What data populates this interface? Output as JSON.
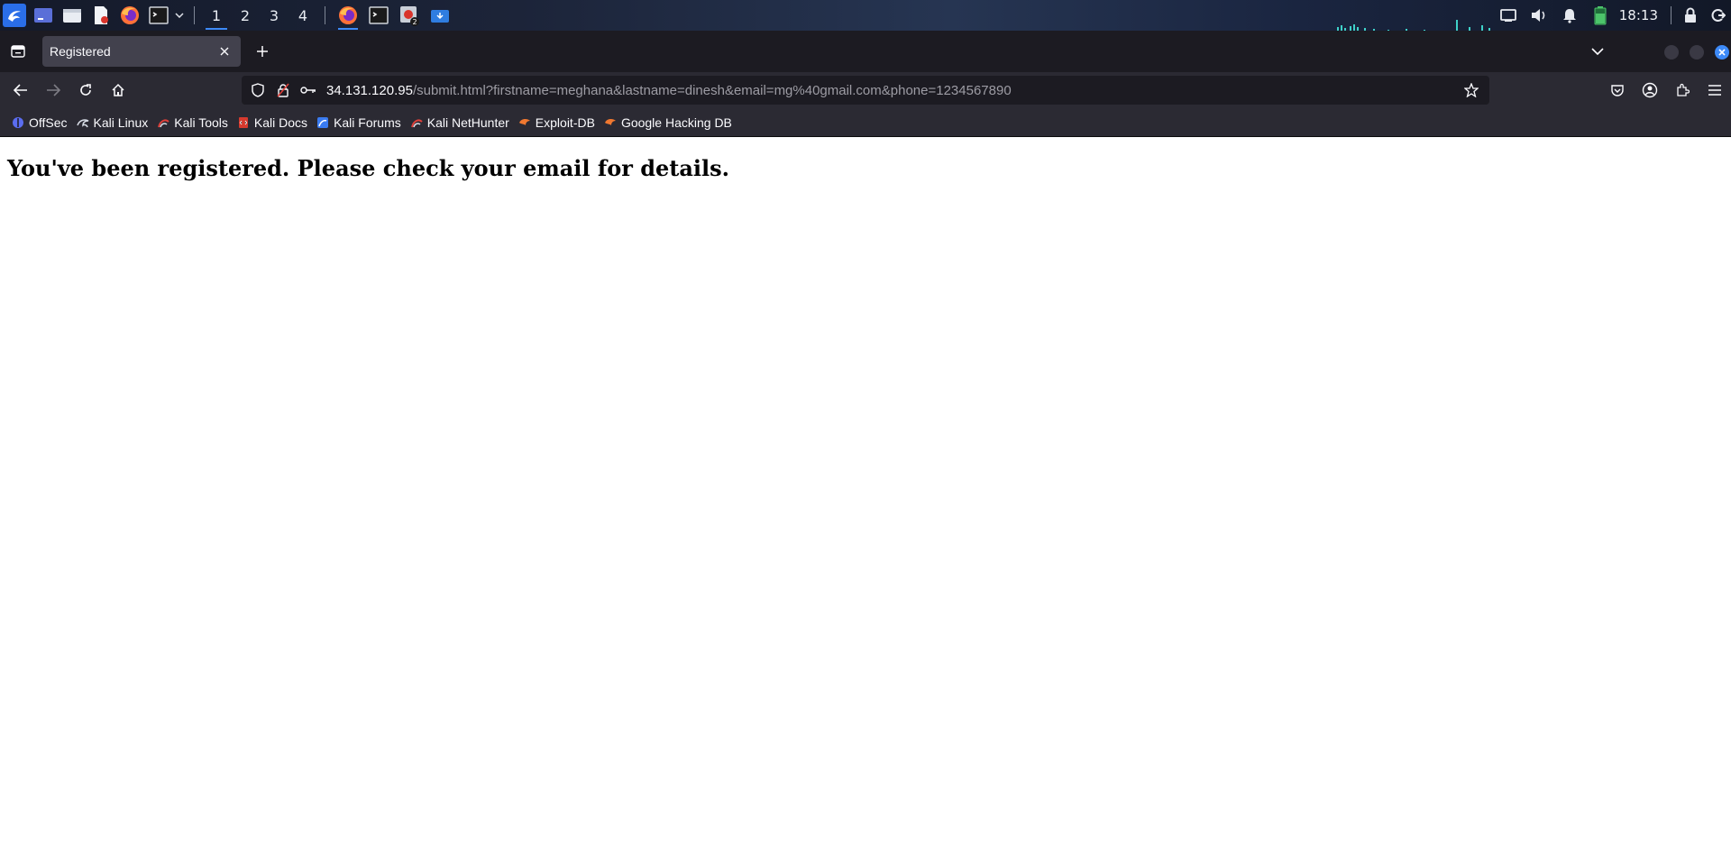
{
  "taskbar": {
    "workspaces": [
      "1",
      "2",
      "3",
      "4"
    ],
    "active_workspace": "1",
    "launchers": [
      "kali-menu-icon",
      "terminal-desktop-icon",
      "file-manager-icon",
      "text-editor-icon",
      "firefox-icon",
      "terminal-icon"
    ],
    "running_apps": [
      "firefox-icon",
      "terminal-icon",
      "screenshot-icon",
      "downloads-icon"
    ],
    "screenshot_badge": "2",
    "clock": "18:13"
  },
  "browser": {
    "tab": {
      "title": "Registered"
    },
    "url": {
      "host": "34.131.120.95",
      "path": "/submit.html?firstname=meghana&lastname=dinesh&email=mg%40gmail.com&phone=1234567890"
    },
    "bookmarks": [
      {
        "label": "OffSec",
        "icon": "offsec-icon",
        "color": "#5b6df0"
      },
      {
        "label": "Kali Linux",
        "icon": "kali-dragon-icon",
        "color": "#d8dde6"
      },
      {
        "label": "Kali Tools",
        "icon": "kali-tools-icon",
        "color": "#e0403a"
      },
      {
        "label": "Kali Docs",
        "icon": "kali-docs-icon",
        "color": "#d63a2e"
      },
      {
        "label": "Kali Forums",
        "icon": "kali-forums-icon",
        "color": "#3a7bf0"
      },
      {
        "label": "Kali NetHunter",
        "icon": "nethunter-icon",
        "color": "#e0403a"
      },
      {
        "label": "Exploit-DB",
        "icon": "exploit-db-icon",
        "color": "#f07830"
      },
      {
        "label": "Google Hacking DB",
        "icon": "ghdb-icon",
        "color": "#f07830"
      }
    ]
  },
  "page": {
    "message": "You've been registered. Please check your email for details."
  },
  "colors": {
    "accent": "#3d8af7",
    "toolbar": "#2b2a33",
    "tabstrip": "#1c1b22"
  }
}
